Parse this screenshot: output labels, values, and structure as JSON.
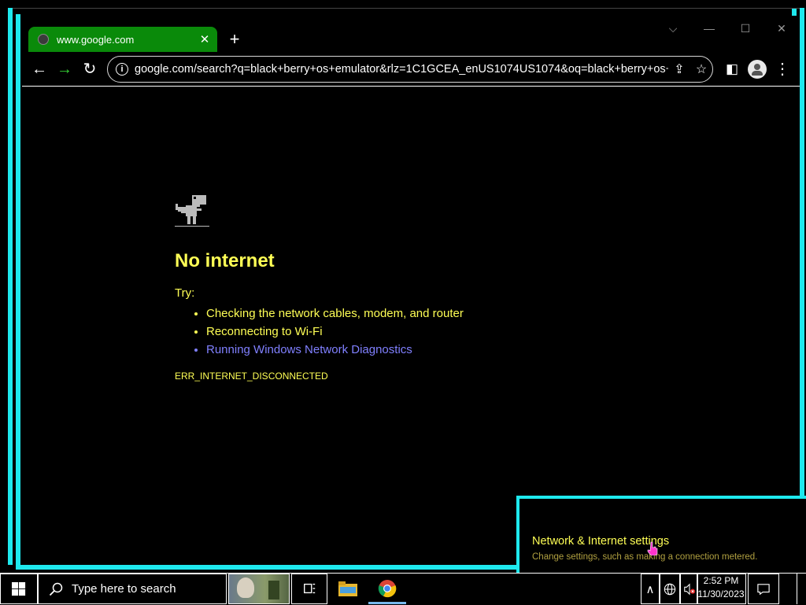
{
  "browser": {
    "tab": {
      "title": "www.google.com",
      "close": "✕"
    },
    "new_tab": "+",
    "window_controls": {
      "tab_search": "⌵",
      "minimize": "—",
      "maximize": "☐",
      "close": "✕"
    },
    "nav": {
      "back": "←",
      "forward": "→",
      "reload": "↻"
    },
    "omnibox": {
      "info": "i",
      "url": "google.com/search?q=black+berry+os+emulator&rlz=1C1GCEA_enUS1074US1074&oq=black+berry+os+...",
      "share": "⇪",
      "bookmark": "☆"
    },
    "toolbar_icons": {
      "side_panel": "◧",
      "profile": "●",
      "menu": "⋮"
    }
  },
  "error_page": {
    "heading": "No internet",
    "try_label": "Try:",
    "suggestions": [
      "Checking the network cables, modem, and router",
      "Reconnecting to Wi-Fi",
      "Running Windows Network Diagnostics"
    ],
    "error_code": "ERR_INTERNET_DISCONNECTED"
  },
  "network_flyout": {
    "title": "Network & Internet settings",
    "subtitle": "Change settings, such as making a connection metered."
  },
  "taskbar": {
    "search_placeholder": "Type here to search",
    "tray_chevron": "∧",
    "clock": {
      "time": "2:52 PM",
      "date": "11/30/2023"
    },
    "notification": "▭"
  },
  "colors": {
    "accent_cyan": "#1ee9ee",
    "text_yellow": "#ffff55",
    "link_blue": "#8080ff",
    "tab_green": "#0a8a0a"
  }
}
